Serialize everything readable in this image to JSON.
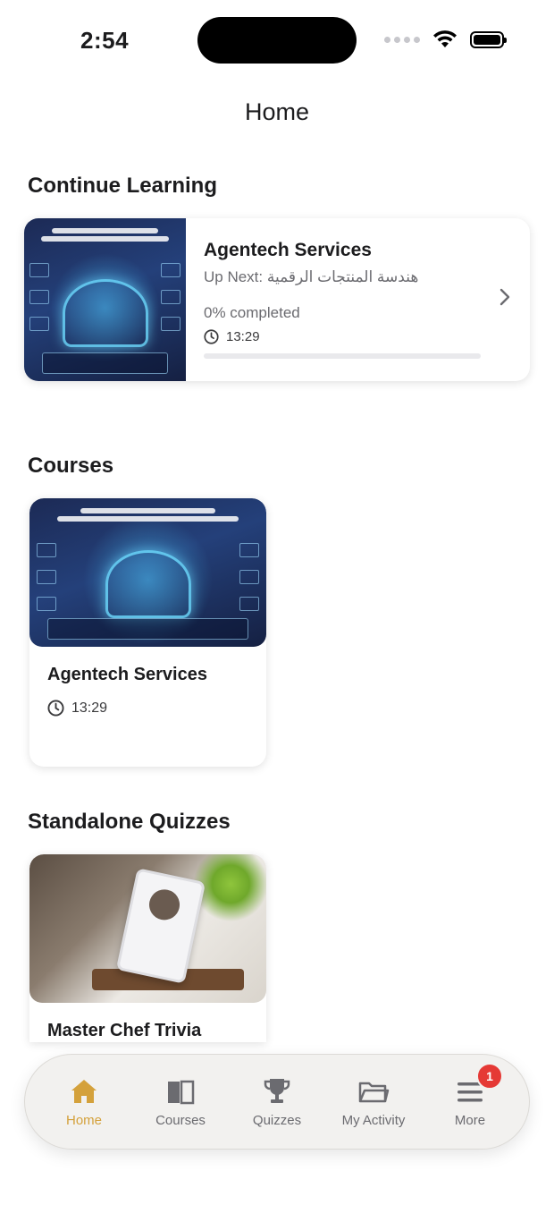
{
  "status_bar": {
    "time": "2:54"
  },
  "header": {
    "title": "Home"
  },
  "continue_learning": {
    "section_title": "Continue Learning",
    "card": {
      "title": "Agentech Services",
      "up_next": "Up Next: هندسة المنتجات الرقمية",
      "progress_text": "0% completed",
      "progress_value": 0,
      "duration": "13:29"
    }
  },
  "courses": {
    "section_title": "Courses",
    "items": [
      {
        "title": "Agentech Services",
        "duration": "13:29"
      }
    ]
  },
  "quizzes": {
    "section_title": "Standalone Quizzes",
    "items": [
      {
        "title": "Master Chef Trivia"
      }
    ]
  },
  "bottom_nav": {
    "items": [
      {
        "label": "Home",
        "icon": "home-icon",
        "active": true
      },
      {
        "label": "Courses",
        "icon": "book-icon"
      },
      {
        "label": "Quizzes",
        "icon": "trophy-icon"
      },
      {
        "label": "My Activity",
        "icon": "folder-icon"
      },
      {
        "label": "More",
        "icon": "menu-icon",
        "badge": "1"
      }
    ]
  },
  "colors": {
    "accent": "#d4a13b",
    "badge": "#e53935"
  }
}
